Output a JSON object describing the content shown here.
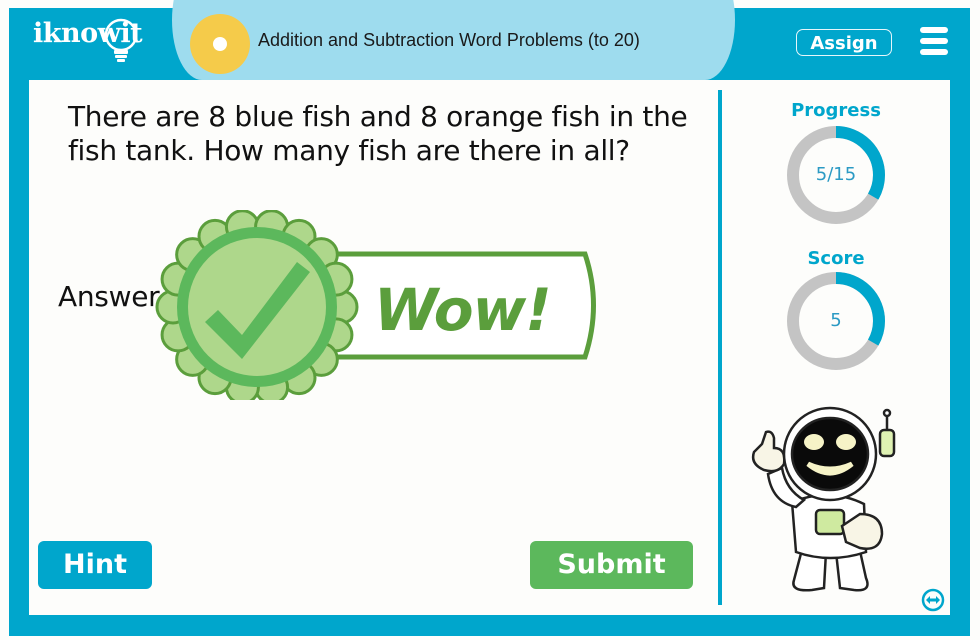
{
  "header": {
    "logo_text": "iknowit",
    "lesson_title": "Addition and Subtraction Word Problems (to 20)",
    "assign_label": "Assign",
    "menu_icon": "hamburger-menu-icon",
    "sun_icon": "sun-badge-icon"
  },
  "question": {
    "text": "There are 8 blue fish and 8 orange fish in the fish tank. How many fish are there in all?",
    "answer_label": "Answer",
    "answer_value": ""
  },
  "feedback": {
    "text": "Wow!",
    "icon": "check-badge-icon"
  },
  "buttons": {
    "hint_label": "Hint",
    "submit_label": "Submit"
  },
  "sidebar": {
    "progress": {
      "label": "Progress",
      "text": "5/15",
      "current": 5,
      "total": 15,
      "fraction": 0.3333
    },
    "score": {
      "label": "Score",
      "text": "5",
      "fraction": 0.3333
    },
    "mascot": "astronaut-robot-mascot",
    "resize_icon": "expand-horizontal-icon"
  },
  "colors": {
    "brand_teal": "#00a6cc",
    "title_band": "#9edcee",
    "sun": "#f5cb4a",
    "success_green": "#5cb85c",
    "wow_green": "#5b9e3c",
    "badge_light_green": "#aed78b",
    "ring_gray": "#c4c4c4"
  }
}
